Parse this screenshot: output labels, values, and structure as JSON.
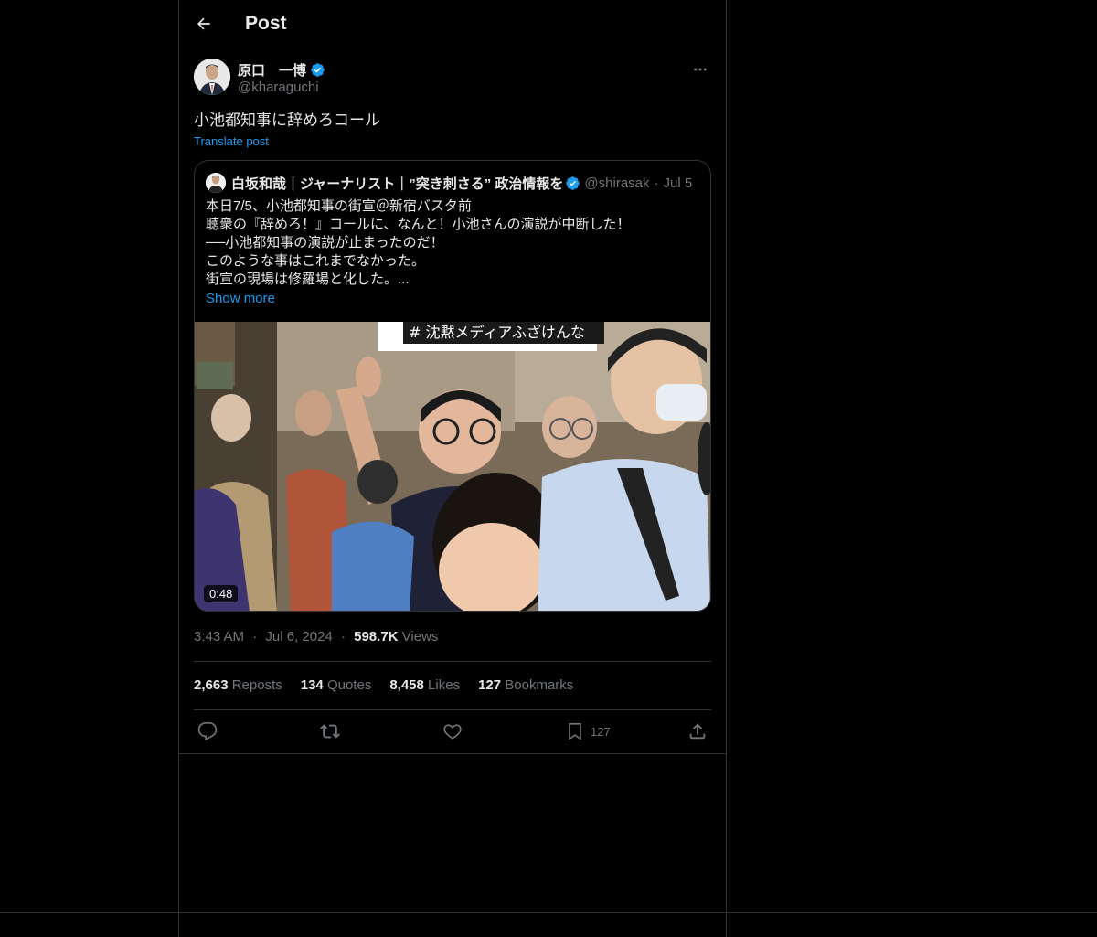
{
  "header": {
    "title": "Post",
    "back_icon": "arrow-left-icon"
  },
  "post": {
    "author": {
      "name": "原口　一博",
      "handle": "@kharaguchi",
      "verified_icon": "verified-badge-icon",
      "verified_color": "#1d9bf0"
    },
    "text": "小池都知事に辞めろコール",
    "translate_label": "Translate post",
    "quote": {
      "author_name": "白坂和哉｜ジャーナリスト｜”突き刺さる” 政治情報を",
      "author_handle": "@shirasak",
      "date": "Jul 5",
      "lines": [
        "本日7/5、小池都知事の街宣＠新宿バスタ前",
        "聴衆の『辞めろ！』コールに、なんと！小池さんの演説が中断した！",
        "──小池都知事の演説が止まったのだ！",
        "このような事はこれまでなかった。",
        "街宣の現場は修羅場と化した。..."
      ],
      "show_more_label": "Show more",
      "media": {
        "sign_text": "# 沈黙メディアふざけんな",
        "duration": "0:48"
      }
    },
    "timestamp": {
      "time": "3:43 AM",
      "date": "Jul 6, 2024",
      "views_count": "598.7K",
      "views_label": "Views"
    },
    "stats": {
      "reposts_count": "2,663",
      "reposts_label": "Reposts",
      "quotes_count": "134",
      "quotes_label": "Quotes",
      "likes_count": "8,458",
      "likes_label": "Likes",
      "bookmarks_count": "127",
      "bookmarks_label": "Bookmarks"
    },
    "actions": {
      "bookmark_count": "127"
    }
  },
  "colors": {
    "background": "#000000",
    "text": "#e7e9ea",
    "muted": "#71767b",
    "border": "#2f3336",
    "accent": "#1d9bf0"
  }
}
